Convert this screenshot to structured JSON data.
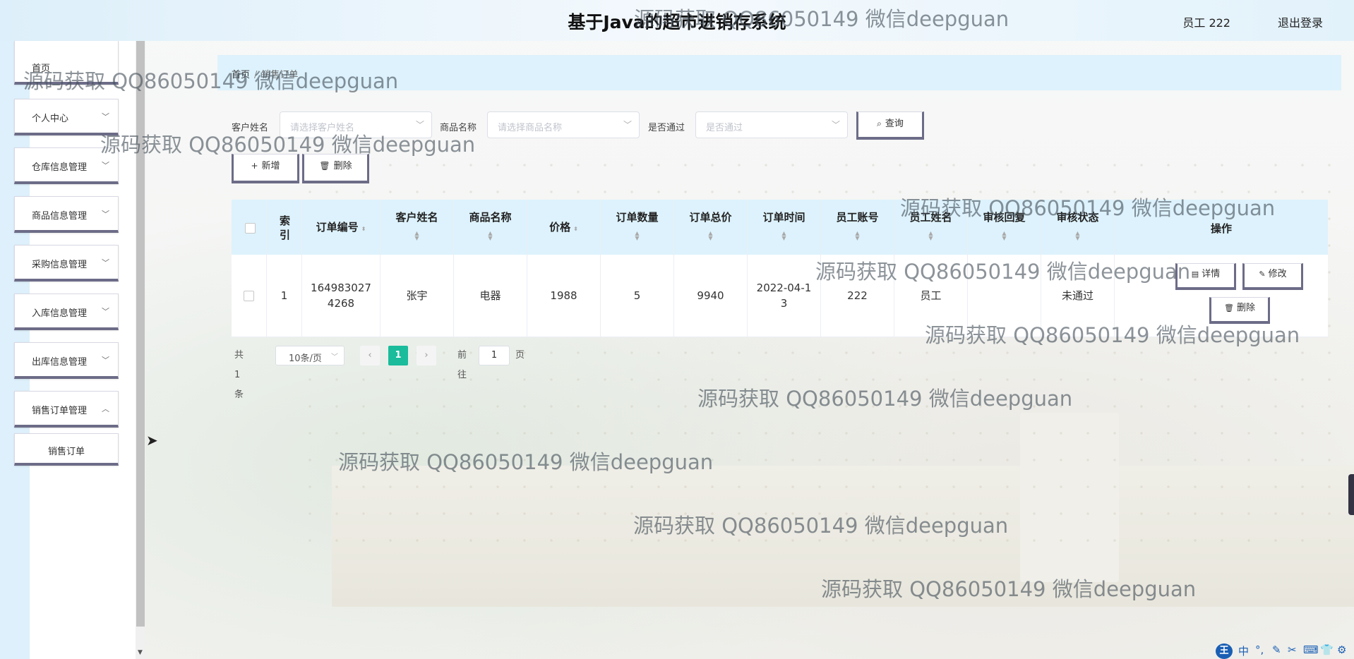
{
  "header": {
    "title": "基于Java的超市进销存系统",
    "user": "员工 222",
    "logout": "退出登录"
  },
  "sidebar": {
    "items": [
      {
        "label": "首页",
        "has_chevron": false
      },
      {
        "label": "个人中心",
        "has_chevron": true
      },
      {
        "label": "仓库信息管理",
        "has_chevron": true
      },
      {
        "label": "商品信息管理",
        "has_chevron": true
      },
      {
        "label": "采购信息管理",
        "has_chevron": true
      },
      {
        "label": "入库信息管理",
        "has_chevron": true
      },
      {
        "label": "出库信息管理",
        "has_chevron": true
      },
      {
        "label": "销售订单管理",
        "has_chevron": true
      },
      {
        "label": "销售订单",
        "has_chevron": false
      }
    ],
    "chevron_icon": "chevron-down-icon"
  },
  "breadcrumb": {
    "home": "首页",
    "separator": "/",
    "current": "销售订单"
  },
  "search": {
    "customer_label": "客户姓名",
    "customer_placeholder": "请选择客户姓名",
    "product_label": "商品名称",
    "product_placeholder": "请选择商品名称",
    "approved_label": "是否通过",
    "approved_placeholder": "是否通过",
    "query_button": "查询"
  },
  "actions": {
    "add": "新增",
    "delete": "删除"
  },
  "table": {
    "columns": [
      "索引",
      "订单编号",
      "客户姓名",
      "商品名称",
      "价格",
      "订单数量",
      "订单总价",
      "订单时间",
      "员工账号",
      "员工姓名",
      "审核回复",
      "审核状态",
      "操作"
    ],
    "rows": [
      {
        "index": "1",
        "order_no": "1649830274268",
        "customer": "张宇",
        "product": "电器",
        "price": "1988",
        "quantity": "5",
        "total": "9940",
        "time": "2022-04-13",
        "emp_account": "222",
        "emp_name": "员工",
        "review_reply": "",
        "review_status": "未通过",
        "ops": {
          "detail": "详情",
          "edit": "修改",
          "delete": "删除"
        }
      }
    ]
  },
  "pagination": {
    "total": "共 1 条",
    "page_size": "10条/页",
    "current_page": "1",
    "goto_label": "前往",
    "goto_value": "1",
    "page_suffix": "页"
  },
  "watermark": "源码获取 QQ86050149 微信deepguan",
  "ime": {
    "logo": "王",
    "mode": "中"
  },
  "colors": {
    "accent": "#1abc9c",
    "table_header_bg": "#ddf2fc",
    "button_border": "#6c6c88",
    "header_bg": "#e6f3fb"
  }
}
